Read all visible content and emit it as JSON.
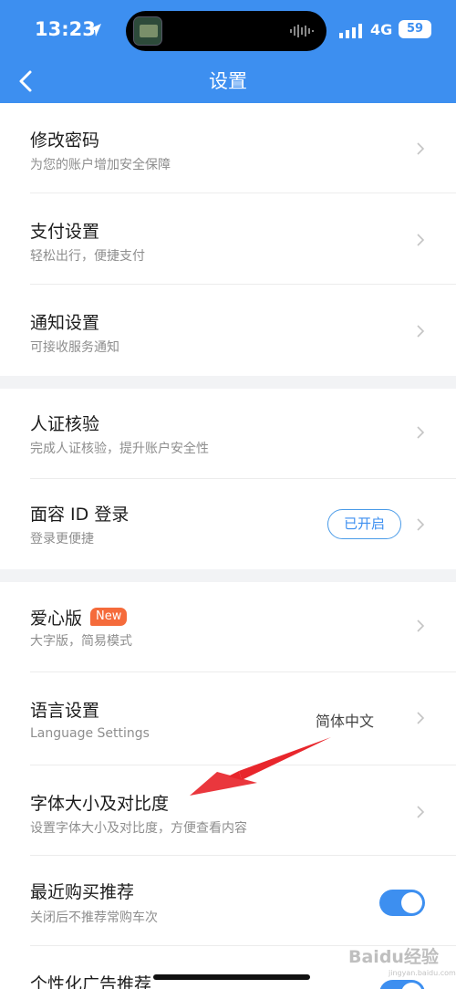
{
  "status_bar": {
    "time": "13:23",
    "network": "4G",
    "battery": "59"
  },
  "nav": {
    "title": "设置"
  },
  "groups": [
    {
      "items": [
        {
          "title": "修改密码",
          "subtitle": "为您的账户增加安全保障"
        },
        {
          "title": "支付设置",
          "subtitle": "轻松出行，便捷支付"
        },
        {
          "title": "通知设置",
          "subtitle": "可接收服务通知"
        }
      ]
    },
    {
      "items": [
        {
          "title": "人证核验",
          "subtitle": "完成人证核验，提升账户安全性"
        },
        {
          "title": "面容 ID 登录",
          "subtitle": "登录更便捷",
          "status": "已开启"
        }
      ]
    },
    {
      "items": [
        {
          "title": "爱心版",
          "badge": "New",
          "subtitle": "大字版，简易模式"
        },
        {
          "title": "语言设置",
          "subtitle": "Language Settings",
          "value": "简体中文"
        },
        {
          "title": "字体大小及对比度",
          "subtitle": "设置字体大小及对比度，方便查看内容"
        },
        {
          "title": "最近购买推荐",
          "subtitle": "关闭后不推荐常购车次",
          "toggle_on": true
        },
        {
          "title": "个性化广告推荐",
          "toggle_on": true
        }
      ]
    }
  ],
  "watermark": {
    "text": "Baidu经验",
    "sub": "jingyan.baidu.com"
  },
  "colors": {
    "accent": "#3d8ff0",
    "new_badge": "#f56b3b",
    "annotation_arrow": "#e8262c"
  }
}
